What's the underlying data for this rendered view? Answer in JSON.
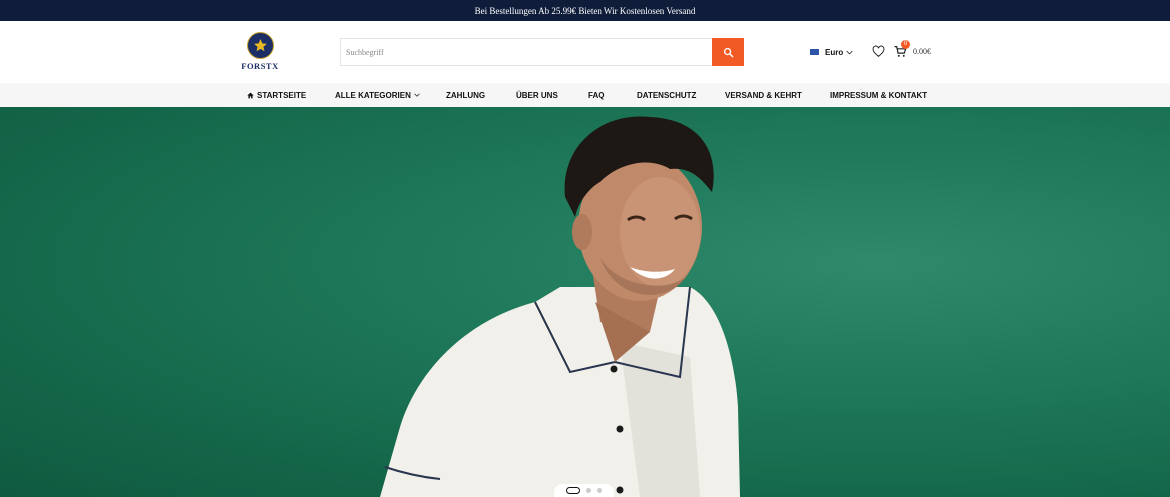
{
  "announcement": {
    "text": "Bei Bestellungen Ab 25.99€ Bieten Wir Kostenlosen Versand"
  },
  "brand": {
    "name": "FORSTX",
    "icon": "star-logo-icon",
    "colors": {
      "navy": "#1b2e66",
      "gold": "#e8b923"
    }
  },
  "search": {
    "placeholder": "Suchbegriff",
    "value": "",
    "button_icon": "search-icon",
    "button_color": "#f15a24"
  },
  "currency": {
    "label": "Euro",
    "icon": "flag-icon"
  },
  "wishlist": {
    "icon": "heart-icon"
  },
  "cart": {
    "icon": "cart-icon",
    "count": "0",
    "total": "0.00€"
  },
  "nav": {
    "items": [
      {
        "label": "STARTSEITE",
        "icon": "home-icon"
      },
      {
        "label": "ALLE KATEGORIEN",
        "icon": "chevron-down-icon"
      },
      {
        "label": "ZAHLUNG"
      },
      {
        "label": "ÜBER UNS"
      },
      {
        "label": "FAQ"
      },
      {
        "label": "DATENSCHUTZ"
      },
      {
        "label": "VERSAND & KEHRT"
      },
      {
        "label": "IMPRESSUM & KONTAKT"
      }
    ]
  },
  "hero": {
    "background": "#1f7a5b",
    "active_slide": 1,
    "slide_count": 3
  },
  "colors": {
    "topbar": "#0f1d3b",
    "accent": "#f15a24",
    "nav_bg": "#f6f6f6"
  }
}
